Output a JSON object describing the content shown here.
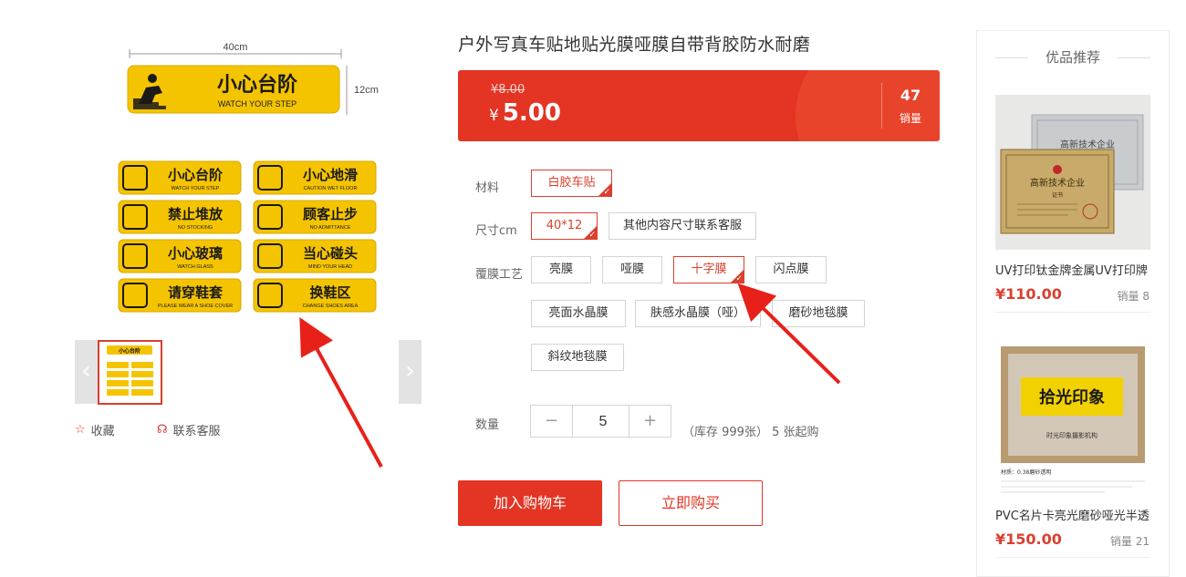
{
  "product": {
    "title": "户外写真车贴地贴光膜哑膜自带背胶防水耐磨",
    "old_price": "¥8.00",
    "currency": "¥",
    "price": "5.00",
    "sales_count": "47",
    "sales_label": "销量"
  },
  "main_image": {
    "size_label": "40cm",
    "height_label": "12cm",
    "hero_sign": {
      "cn": "小心台阶",
      "en": "WATCH YOUR STEP"
    },
    "signs": [
      {
        "cn": "小心台阶",
        "en": "WATCH YOUR STEP"
      },
      {
        "cn": "小心地滑",
        "en": "CAUTION WET FLOOR"
      },
      {
        "cn": "禁止堆放",
        "en": "NO STOCKING"
      },
      {
        "cn": "顾客止步",
        "en": "NO ADMITTANCE"
      },
      {
        "cn": "小心玻璃",
        "en": "WATCH GLASS"
      },
      {
        "cn": "当心碰头",
        "en": "MIND YOUR HEAD"
      },
      {
        "cn": "请穿鞋套",
        "en": "PLEASE WEAR A SHOE COVER"
      },
      {
        "cn": "换鞋区",
        "en": "CHANGE SHOES AREA"
      }
    ]
  },
  "thumbs": {
    "prev_arrow": "‹",
    "next_arrow": "›",
    "thumb_sign": "小心台阶"
  },
  "side_actions": {
    "favorite_label": "收藏",
    "service_label": "联系客服"
  },
  "options": {
    "material": {
      "label": "材料",
      "values": [
        "白胶车贴"
      ],
      "selected": "白胶车贴"
    },
    "size": {
      "label": "尺寸cm",
      "values": [
        "40*12",
        "其他内容尺寸联系客服"
      ],
      "selected": "40*12"
    },
    "lamination": {
      "label": "覆膜工艺",
      "values": [
        "亮膜",
        "哑膜",
        "十字膜",
        "闪点膜",
        "亮面水晶膜",
        "肤感水晶膜（哑）",
        "磨砂地毯膜",
        "斜纹地毯膜"
      ],
      "selected": "十字膜"
    }
  },
  "quantity": {
    "label": "数量",
    "minus": "−",
    "plus": "+",
    "value": "5",
    "stock_text": "（库存 999张）  5 张起购"
  },
  "buttons": {
    "add_to_cart": "加入购物车",
    "buy_now": "立即购买"
  },
  "recommend": {
    "title": "优品推荐",
    "items": [
      {
        "name": "UV打印钛金牌金属UV打印牌",
        "price": "¥110.00",
        "sales": "销量 8",
        "plaque_text": "高新技术企业",
        "plaque_sub": "证书"
      },
      {
        "name": "PVC名片卡亮光磨砂哑光半透",
        "price": "¥150.00",
        "sales": "销量 21",
        "card_brand": "拾光印象",
        "card_sub": "时光印象摄影机构",
        "card_note": "材质：0.38磨砂透明"
      }
    ]
  },
  "colors": {
    "accent": "#e33424",
    "selected_border": "#d9402f",
    "sign_yellow": "#f5c400",
    "annotation_arrow": "#e8201a"
  }
}
